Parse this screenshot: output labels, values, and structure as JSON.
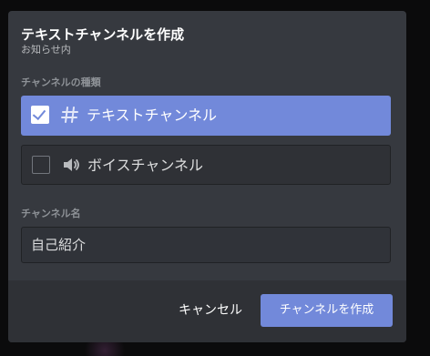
{
  "modal": {
    "title": "テキストチャンネルを作成",
    "subtitle": "お知らせ内"
  },
  "channel_type": {
    "label": "チャンネルの種類",
    "options": [
      {
        "label": "テキストチャンネル",
        "icon": "hash-icon",
        "selected": true
      },
      {
        "label": "ボイスチャンネル",
        "icon": "speaker-icon",
        "selected": false
      }
    ]
  },
  "channel_name": {
    "label": "チャンネル名",
    "value": "自己紹介"
  },
  "footer": {
    "cancel_label": "キャンセル",
    "create_label": "チャンネルを作成"
  },
  "colors": {
    "accent": "#7289da",
    "modal_bg": "#36393f",
    "footer_bg": "#2f3136"
  }
}
